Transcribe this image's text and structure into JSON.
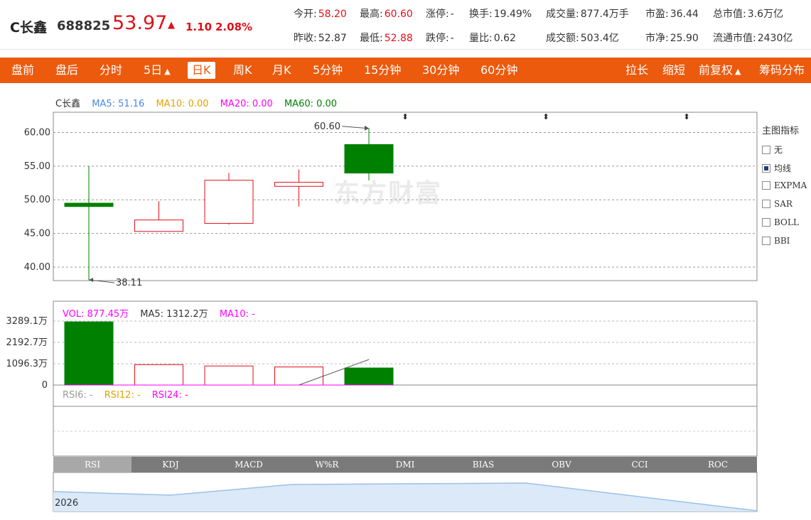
{
  "header": {
    "name": "C长鑫",
    "code": "688825",
    "price": "53.97",
    "arrow": "▲",
    "change": "1.10",
    "change_pct": "2.08%",
    "fields": [
      {
        "label": "今开:",
        "value": "58.20",
        "color": "red"
      },
      {
        "label": "最高:",
        "value": "60.60",
        "color": "red"
      },
      {
        "label": "涨停:",
        "value": "-",
        "color": ""
      },
      {
        "label": "换手:",
        "value": "19.49%",
        "color": ""
      },
      {
        "label": "成交量:",
        "value": "877.4万手",
        "color": ""
      },
      {
        "label": "市盈:",
        "value": "36.44",
        "color": ""
      },
      {
        "label": "总市值:",
        "value": "3.6万亿",
        "color": ""
      },
      {
        "label": "昨收:",
        "value": "52.87",
        "color": ""
      },
      {
        "label": "最低:",
        "value": "52.88",
        "color": "red"
      },
      {
        "label": "跌停:",
        "value": "-",
        "color": ""
      },
      {
        "label": "量比:",
        "value": "0.62",
        "color": ""
      },
      {
        "label": "成交额:",
        "value": "503.4亿",
        "color": ""
      },
      {
        "label": "市净:",
        "value": "25.90",
        "color": ""
      },
      {
        "label": "流通市值:",
        "value": "2430亿",
        "color": ""
      }
    ]
  },
  "tabs_left": [
    {
      "label": "盘前",
      "active": false
    },
    {
      "label": "盘后",
      "active": false
    },
    {
      "label": "分时",
      "active": false
    },
    {
      "label": "5日",
      "active": false,
      "caret": true
    },
    {
      "label": "日K",
      "active": true
    },
    {
      "label": "周K",
      "active": false
    },
    {
      "label": "月K",
      "active": false
    },
    {
      "label": "5分钟",
      "active": false
    },
    {
      "label": "15分钟",
      "active": false
    },
    {
      "label": "30分钟",
      "active": false
    },
    {
      "label": "60分钟",
      "active": false
    }
  ],
  "tabs_right": [
    {
      "label": "拉长"
    },
    {
      "label": "缩短"
    },
    {
      "label": "前复权",
      "caret": true
    },
    {
      "label": "筹码分布"
    }
  ],
  "caret_glyph": "▲",
  "main_legend": {
    "name": "C长鑫",
    "ma5": "MA5: 51.16",
    "ma10": "MA10: 0.00",
    "ma20": "MA20: 0.00",
    "ma60": "MA60: 0.00"
  },
  "vol_legend": {
    "vol": "VOL: 877.45万",
    "ma5": "MA5: 1312.2万",
    "ma10": "MA10: -"
  },
  "rsi_legend": {
    "rsi6": "RSI6: -",
    "rsi12": "RSI12: -",
    "rsi24": "RSI24: -"
  },
  "side_panel": {
    "title": "主图指标",
    "items": [
      {
        "label": "无",
        "checked": false
      },
      {
        "label": "均线",
        "checked": true
      },
      {
        "label": "EXPMA",
        "checked": false
      },
      {
        "label": "SAR",
        "checked": false
      },
      {
        "label": "BOLL",
        "checked": false
      },
      {
        "label": "BBI",
        "checked": false
      }
    ]
  },
  "indicator_tabs": [
    "RSI",
    "KDJ",
    "MACD",
    "W%R",
    "DMI",
    "BIAS",
    "OBV",
    "CCI",
    "ROC"
  ],
  "active_indicator": "RSI",
  "watermark": "东方财富",
  "nav_year": "2026",
  "colors": {
    "up": "#e0101a",
    "down": "#008000",
    "accent": "#ec5a0e",
    "ma5": "#4a86e8",
    "ma10": "#e6a000",
    "ma20": "#ff00ff",
    "ma60": "#008000"
  },
  "chart_data": {
    "type": "candlestick",
    "ylim": [
      38,
      63
    ],
    "y_ticks": [
      "60.00",
      "55.00",
      "50.00",
      "45.00",
      "40.00"
    ],
    "y_tick_values": [
      60,
      55,
      50,
      45,
      40
    ],
    "candles": [
      {
        "open": 49.5,
        "close": 49.0,
        "high": 55.0,
        "low": 38.11,
        "dir": "down"
      },
      {
        "open": 45.3,
        "close": 47.0,
        "high": 49.8,
        "low": 45.3,
        "dir": "up"
      },
      {
        "open": 46.5,
        "close": 52.9,
        "high": 54.0,
        "low": 46.3,
        "dir": "up"
      },
      {
        "open": 52.0,
        "close": 52.6,
        "high": 54.5,
        "low": 49.0,
        "dir": "up"
      },
      {
        "open": 58.2,
        "close": 53.97,
        "high": 60.6,
        "low": 52.88,
        "dir": "down"
      }
    ],
    "high_annotation": "60.60",
    "low_annotation": "38.11",
    "volume": {
      "ylim": [
        0,
        3289.1
      ],
      "y_ticks": [
        "3289.1万",
        "2192.7万",
        "1096.3万",
        "0"
      ],
      "y_tick_values": [
        3289.1,
        2192.7,
        1096.3,
        0
      ],
      "values": [
        3250,
        1050,
        980,
        930,
        877.45
      ],
      "ma5_line": [
        {
          "i": 3,
          "v": 0
        },
        {
          "i": 4,
          "v": 1312.2
        }
      ]
    }
  }
}
